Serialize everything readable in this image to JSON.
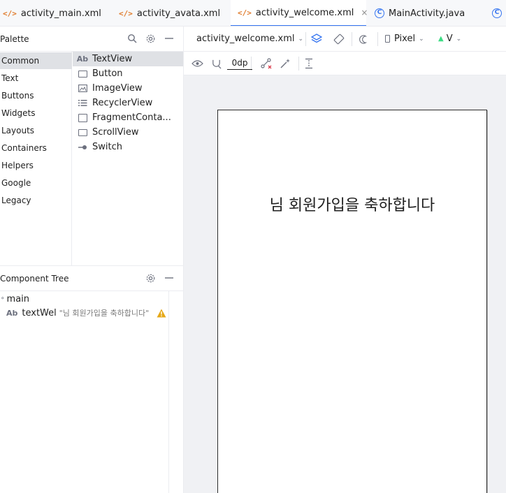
{
  "tabs": [
    {
      "label": "activity_main.xml",
      "icon": "xml-icon",
      "active": false
    },
    {
      "label": "activity_avata.xml",
      "icon": "xml-icon",
      "active": false
    },
    {
      "label": "activity_welcome.xml",
      "icon": "xml-icon",
      "active": true,
      "close": "×"
    },
    {
      "label": "MainActivity.java",
      "icon": "class-icon",
      "active": false
    }
  ],
  "palette": {
    "title": "Palette",
    "categories": [
      "Common",
      "Text",
      "Buttons",
      "Widgets",
      "Layouts",
      "Containers",
      "Helpers",
      "Google",
      "Legacy"
    ],
    "selected_category": "Common",
    "widgets": [
      {
        "label": "TextView",
        "icon": "textview-icon"
      },
      {
        "label": "Button",
        "icon": "button-icon"
      },
      {
        "label": "ImageView",
        "icon": "imageview-icon"
      },
      {
        "label": "RecyclerView",
        "icon": "recyclerview-icon"
      },
      {
        "label": "FragmentConta...",
        "icon": "fragmentcontainer-icon"
      },
      {
        "label": "ScrollView",
        "icon": "scrollview-icon"
      },
      {
        "label": "Switch",
        "icon": "switch-icon"
      }
    ]
  },
  "component_tree": {
    "title": "Component Tree",
    "root": "main",
    "child_label": "textWel",
    "child_hint": "\"님 회원가입을 축하합니다\"",
    "ab_glyph": "Ab"
  },
  "design_toolbar": {
    "file_label": "activity_welcome.xml",
    "device_label": "Pixel",
    "api_label": "V",
    "default_margin": "0dp"
  },
  "canvas": {
    "welcome_text": "님 회원가입을 축하합니다"
  },
  "colors": {
    "accent": "#3574f0",
    "xml_icon": "#e07b2c",
    "warning": "#e6a817"
  }
}
